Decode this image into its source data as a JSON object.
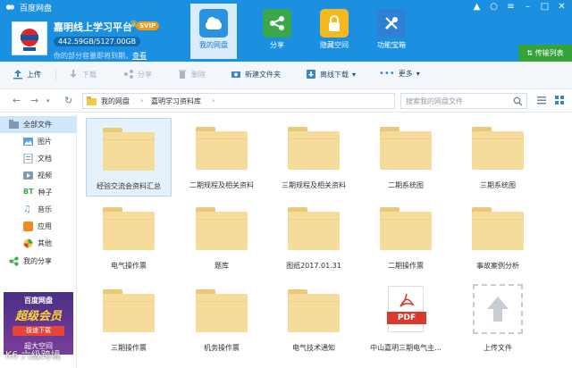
{
  "app": {
    "title": "百度网盘"
  },
  "profile": {
    "username": "嘉明线上学习平台",
    "badge": "SVIP",
    "quota": "442.59GB/5127.00GB",
    "expire_text": "你的部分容量即将到期，",
    "renew_link": "查看"
  },
  "main_tabs": [
    {
      "label": "我的网盘"
    },
    {
      "label": "分享"
    },
    {
      "label": "隐藏空间"
    },
    {
      "label": "功能宝箱"
    }
  ],
  "transfer_label": "传输列表",
  "toolbar": {
    "upload": "上传",
    "download": "下载",
    "share": "分享",
    "delete": "删除",
    "new_folder": "新建文件夹",
    "offline": "离线下载",
    "more": "更多"
  },
  "breadcrumb": {
    "root": "我的网盘",
    "current": "嘉明学习资料库"
  },
  "search": {
    "placeholder": "搜索我的网盘文件"
  },
  "sidebar": {
    "items": [
      {
        "label": "全部文件"
      },
      {
        "label": "图片"
      },
      {
        "label": "文档"
      },
      {
        "label": "视频"
      },
      {
        "label": "种子"
      },
      {
        "label": "音乐"
      },
      {
        "label": "应用"
      },
      {
        "label": "其他"
      },
      {
        "label": "我的分享"
      }
    ]
  },
  "promo": {
    "line1": "百度网盘",
    "line2": "超级会员",
    "button": "极速下载",
    "line3": "超大空间"
  },
  "watermark": "K6 六级跨境",
  "files": [
    {
      "name": "经验交流会资料汇总",
      "type": "folder"
    },
    {
      "name": "二期规程及相关资料",
      "type": "folder"
    },
    {
      "name": "三期规程及相关资料",
      "type": "folder"
    },
    {
      "name": "二期系统图",
      "type": "folder"
    },
    {
      "name": "三期系统图",
      "type": "folder"
    },
    {
      "name": "电气操作票",
      "type": "folder"
    },
    {
      "name": "题库",
      "type": "folder"
    },
    {
      "name": "图纸2017.01.31",
      "type": "folder"
    },
    {
      "name": "二期操作票",
      "type": "folder"
    },
    {
      "name": "事故案例分析",
      "type": "folder"
    },
    {
      "name": "三期操作票",
      "type": "folder"
    },
    {
      "name": "机务操作票",
      "type": "folder"
    },
    {
      "name": "电气技术通知",
      "type": "folder"
    },
    {
      "name": "中山嘉明三期电气主...",
      "type": "pdf",
      "badge": "PDF"
    },
    {
      "name": "上传文件",
      "type": "upload"
    }
  ],
  "colors": {
    "header": "#1b8fe0",
    "folder": "#f6dc9b",
    "transfer": "#36a33a"
  }
}
